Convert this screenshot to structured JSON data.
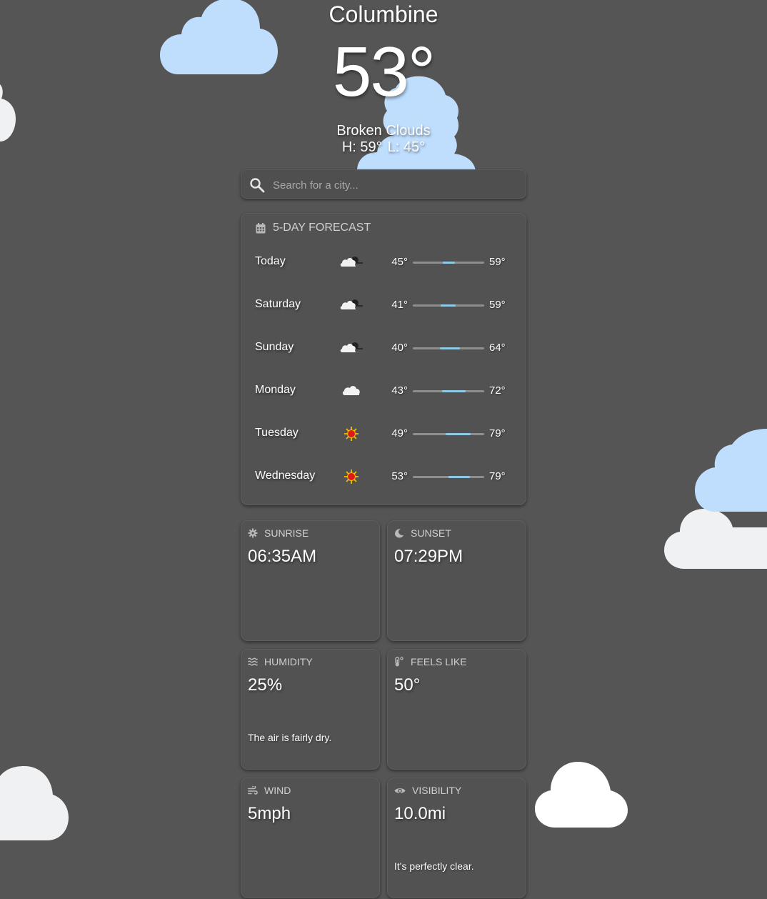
{
  "location": {
    "city": "Columbine",
    "temperature": "53°",
    "condition": "Broken Clouds",
    "high": "H: 59°",
    "low": "L: 45°"
  },
  "search": {
    "placeholder": "Search for a city...",
    "icon": "search-icon"
  },
  "forecast": {
    "title": "5-DAY FORECAST",
    "icon": "calendar-icon",
    "range_min": 40,
    "range_max": 79,
    "days": [
      {
        "day": "Today",
        "icon": "partly-cloudy-night-icon",
        "low": "45°",
        "high": "59°",
        "low_val": 45,
        "high_val": 59
      },
      {
        "day": "Saturday",
        "icon": "partly-cloudy-night-icon",
        "low": "41°",
        "high": "59°",
        "low_val": 41,
        "high_val": 59
      },
      {
        "day": "Sunday",
        "icon": "partly-cloudy-night-icon",
        "low": "40°",
        "high": "64°",
        "low_val": 40,
        "high_val": 64
      },
      {
        "day": "Monday",
        "icon": "cloud-icon",
        "low": "43°",
        "high": "72°",
        "low_val": 43,
        "high_val": 72
      },
      {
        "day": "Tuesday",
        "icon": "sun-icon",
        "low": "49°",
        "high": "79°",
        "low_val": 49,
        "high_val": 79
      },
      {
        "day": "Wednesday",
        "icon": "sun-icon",
        "low": "53°",
        "high": "79°",
        "low_val": 53,
        "high_val": 79
      }
    ]
  },
  "tiles": {
    "sunrise": {
      "label": "SUNRISE",
      "value": "06:35AM",
      "icon": "sun-gear-icon"
    },
    "sunset": {
      "label": "SUNSET",
      "value": "07:29PM",
      "icon": "moon-icon"
    },
    "humidity": {
      "label": "HUMIDITY",
      "value": "25%",
      "note": "The air is fairly dry.",
      "icon": "water-icon"
    },
    "feels_like": {
      "label": "FEELS LIKE",
      "value": "50°",
      "icon": "thermometer-icon"
    },
    "wind": {
      "label": "WIND",
      "value": "5mph",
      "icon": "wind-icon"
    },
    "visibility": {
      "label": "VISIBILITY",
      "value": "10.0mi",
      "note": "It's perfectly clear.",
      "icon": "eye-icon"
    }
  },
  "colors": {
    "background": "#555555",
    "card": "#525252",
    "bar_track": "#8e8e8e",
    "bar_fill": "#8ecae6",
    "cloud_blue": "#bfdefe",
    "cloud_white": "#f0f1f3",
    "sun": "#f0c000",
    "sun_core": "#e01818"
  }
}
